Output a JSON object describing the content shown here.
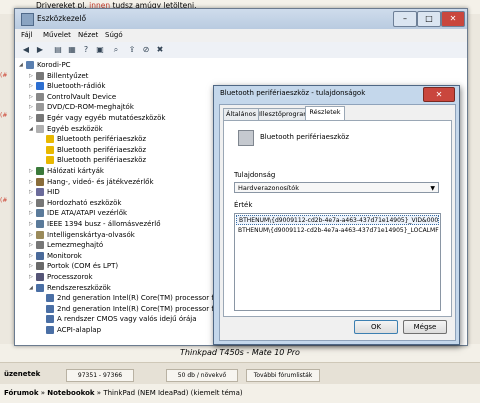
{
  "forum": {
    "top_text_before": "Drivereket pl. ",
    "top_link": "innen",
    "top_text_after": " tudsz amúgy letölteni.",
    "caption": "Thinkpad T450s - Mate 10 Pro",
    "nav_label": "üzenetek",
    "nav_range": "97351 - 97366",
    "nav_per_page": "50 db / növekvő",
    "nav_more": "További fórumlisták",
    "crumbs": [
      "Fórumok",
      "Notebookok",
      "ThinkPad (NEM IdeaPad) (kiemelt téma)"
    ]
  },
  "window": {
    "title": "Eszközkezelő",
    "min": "–",
    "max": "□",
    "close": "✕"
  },
  "menu": [
    "Fájl",
    "Művelet",
    "Nézet",
    "Súgó"
  ],
  "toolbar": [
    "back-icon",
    "forward-icon",
    "view-icon",
    "properties-icon",
    "help-icon",
    "refresh-icon",
    "scan-icon",
    "update-driver-icon",
    "disable-icon",
    "uninstall-icon"
  ],
  "tree": [
    {
      "label": "Korodi-PC",
      "level": 0,
      "icon": "computer-icon",
      "expander": "◢"
    },
    {
      "label": "Billentyűzet",
      "level": 1,
      "icon": "keyboard-icon",
      "expander": "▷"
    },
    {
      "label": "Bluetooth-rádiók",
      "level": 1,
      "icon": "bluetooth-icon",
      "expander": "▷"
    },
    {
      "label": "ControlVault Device",
      "level": 1,
      "icon": "device-icon",
      "expander": "▷"
    },
    {
      "label": "DVD/CD-ROM-meghajtók",
      "level": 1,
      "icon": "dvd-icon",
      "expander": "▷"
    },
    {
      "label": "Egér vagy egyéb mutatóeszközök",
      "level": 1,
      "icon": "mouse-icon",
      "expander": "▷"
    },
    {
      "label": "Egyéb eszközök",
      "level": 1,
      "icon": "unknown-device-icon",
      "expander": "◢"
    },
    {
      "label": "Bluetooth perifériaeszköz",
      "level": 2,
      "icon": "warning-device-icon",
      "expander": ""
    },
    {
      "label": "Bluetooth perifériaeszköz",
      "level": 2,
      "icon": "warning-device-icon",
      "expander": ""
    },
    {
      "label": "Bluetooth perifériaeszköz",
      "level": 2,
      "icon": "warning-device-icon",
      "expander": ""
    },
    {
      "label": "Hálózati kártyák",
      "level": 1,
      "icon": "network-icon",
      "expander": "▷"
    },
    {
      "label": "Hang-, videó- és játékvezérlők",
      "level": 1,
      "icon": "sound-icon",
      "expander": "▷"
    },
    {
      "label": "HID",
      "level": 1,
      "icon": "hid-icon",
      "expander": "▷"
    },
    {
      "label": "Hordozható eszközök",
      "level": 1,
      "icon": "portable-icon",
      "expander": "▷"
    },
    {
      "label": "IDE ATA/ATAPI vezérlők",
      "level": 1,
      "icon": "ide-icon",
      "expander": "▷"
    },
    {
      "label": "IEEE 1394 busz - állomásvezérlő",
      "level": 1,
      "icon": "ieee1394-icon",
      "expander": "▷"
    },
    {
      "label": "Intelligenskártya-olvasók",
      "level": 1,
      "icon": "smartcard-icon",
      "expander": "▷"
    },
    {
      "label": "Lemezmeghajtó",
      "level": 1,
      "icon": "disk-icon",
      "expander": "▷"
    },
    {
      "label": "Monitorok",
      "level": 1,
      "icon": "monitor-icon",
      "expander": "▷"
    },
    {
      "label": "Portok (COM és LPT)",
      "level": 1,
      "icon": "port-icon",
      "expander": "▷"
    },
    {
      "label": "Processzorok",
      "level": 1,
      "icon": "cpu-icon",
      "expander": "▷"
    },
    {
      "label": "Rendszereszközök",
      "level": 1,
      "icon": "system-icon",
      "expander": "◢"
    },
    {
      "label": "2nd generation Intel(R) Core(TM) processor family",
      "level": 2,
      "icon": "system-icon",
      "expander": ""
    },
    {
      "label": "2nd generation Intel(R) Core(TM) processor family",
      "level": 2,
      "icon": "system-icon",
      "expander": ""
    },
    {
      "label": "A rendszer CMOS vagy valós idejű órája",
      "level": 2,
      "icon": "system-icon",
      "expander": ""
    },
    {
      "label": "ACPI-alaplap",
      "level": 2,
      "icon": "system-icon",
      "expander": ""
    }
  ],
  "dialog": {
    "title": "Bluetooth perifériaeszköz - tulajdonságok",
    "close": "✕",
    "tabs": [
      "Általános",
      "Illesztőprogram",
      "Részletek"
    ],
    "active_tab": 2,
    "device_name": "Bluetooth perifériaeszköz",
    "property_label": "Tulajdonság",
    "property_value": "Hardverazonosítók",
    "value_label": "Érték",
    "values": [
      "BTHENUM\\{d9009112-cd2b-4e7a-a463-437d71e14905}_VID&00010006",
      "BTHENUM\\{d9009112-cd2b-4e7a-a463-437d71e14905}_LOCALMFG&0000"
    ],
    "ok": "OK",
    "cancel": "Mégse"
  },
  "colors": {
    "accent": "#3c7fb1",
    "link": "#c0392b",
    "close_red": "#c9463d",
    "warning": "#e8b800"
  }
}
